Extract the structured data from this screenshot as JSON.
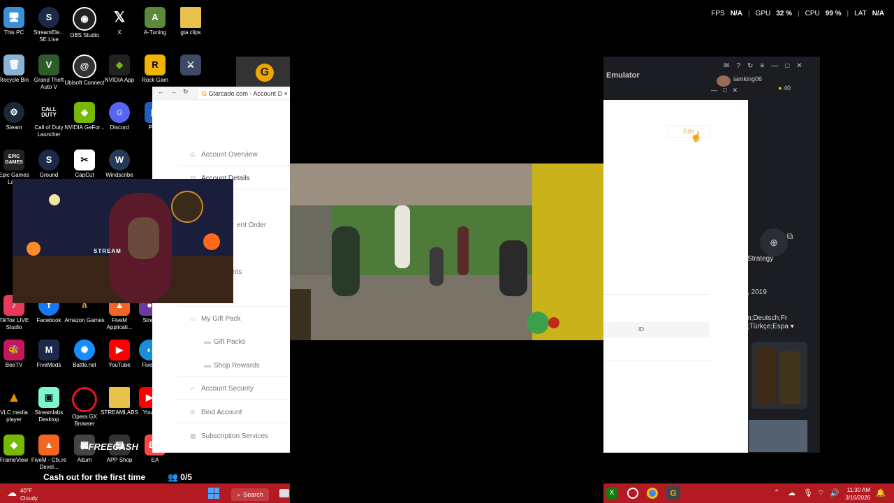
{
  "stats": {
    "fps_label": "FPS",
    "fps_value": "N/A",
    "gpu_label": "GPU",
    "gpu_value": "32 %",
    "cpu_label": "CPU",
    "cpu_value": "99 %",
    "lat_label": "LAT",
    "lat_value": "N/A"
  },
  "desktop_icons": {
    "this_pc": "This PC",
    "streamelements": "StreamEle... SE.Live",
    "obs": "OBS Studio",
    "x": "X",
    "a_tuning": "A-Tuning",
    "gta_clips": "gta clips",
    "recycle_bin": "Recycle Bin",
    "gta_v": "Grand Theft Auto V",
    "ubisoft": "Ubisoft Connect",
    "nvidia_app": "NVIDIA App",
    "rockstar": "Rock Gam",
    "steam": "Steam",
    "cod": "Call of Duty Launcher",
    "geforce": "NVIDIA GeFor...",
    "discord": "Discord",
    "ps_remote": "PS R",
    "epic": "Epic Games Laun",
    "ground": "Ground",
    "capcut": "CapCut",
    "windscribe": "Windscribe",
    "tiktok": "TikTok LIVE Studio",
    "facebook": "Facebook",
    "amazon": "Amazon Games",
    "fivem_app": "FiveM Applicati...",
    "stream": "Strea",
    "beetv": "BeeTV",
    "fivemods": "FiveMods",
    "battlenet": "Battle.net",
    "youtube": "YouTube",
    "fivem": "FiveM",
    "vlc": "VLC media player",
    "streamlabs_desktop": "Streamlabs Desktop",
    "opera": "Opera GX Browser",
    "streamlabs": "STREAMLABS",
    "youtu": "YouT",
    "frameview": "FrameView",
    "fivem_cfx": "FiveM - Cfx.re Devel...",
    "aitum": "Aitum",
    "app_shop": "APP Shop",
    "ea": "EA"
  },
  "browser": {
    "tab_title": "Gtarcade.com - Account D",
    "menu": {
      "account_overview": "Account Overview",
      "account_details": "Account Details",
      "recent_order": "ent Order",
      "points": "nts",
      "my_gift_pack": "My Gift Pack",
      "gift_packs": "Gift Packs",
      "shop_rewards": "Shop Rewards",
      "account_security": "Account Security",
      "bind_account": "Bind Account",
      "subscription_services": "Subscription Services"
    }
  },
  "right_app": {
    "title": "Emulator",
    "username": "iamking06",
    "coins": "40",
    "edit_label": "Edit",
    "id_label": "ID",
    "strategy_label": "Strategy",
    "date_fragment": ", 2019",
    "languages_line1": "n;Deutsch;Fr",
    "languages_line2": ";Türkçe;Espa"
  },
  "webcam": {
    "overlay_text": "STREAM"
  },
  "freecash": {
    "logo": "FREECASH",
    "promo": "Cash out for the first time",
    "progress": "0/5"
  },
  "weather": {
    "temp": "40°F",
    "condition": "Cloudy"
  },
  "taskbar": {
    "search_label": "Search",
    "time": "11:30 AM",
    "date": "3/16/2026"
  }
}
